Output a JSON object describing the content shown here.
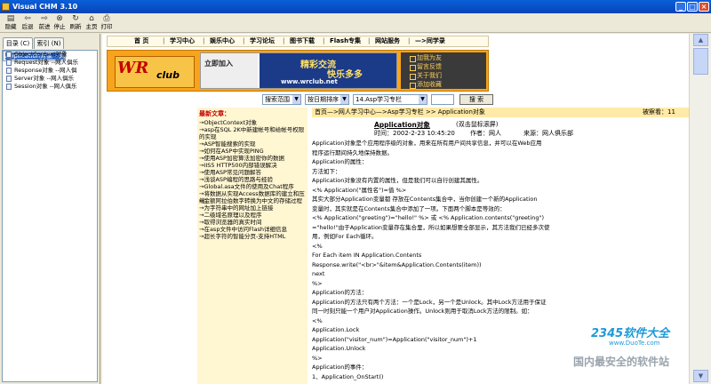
{
  "window": {
    "title": "Visual CHM 3.10",
    "minimize_glyph": "_",
    "maximize_glyph": "□",
    "close_glyph": "×"
  },
  "toolbar": {
    "buttons": [
      {
        "label": "隐藏",
        "icon": "hide-icon",
        "glyph": "▤"
      },
      {
        "label": "后退",
        "icon": "back-icon",
        "glyph": "⇦"
      },
      {
        "label": "前进",
        "icon": "forward-icon",
        "glyph": "⇨"
      },
      {
        "label": "停止",
        "icon": "stop-icon",
        "glyph": "⊗"
      },
      {
        "label": "刷新",
        "icon": "refresh-icon",
        "glyph": "↻"
      },
      {
        "label": "主页",
        "icon": "home-icon",
        "glyph": "⌂"
      },
      {
        "label": "打印",
        "icon": "print-icon",
        "glyph": "⎙"
      }
    ]
  },
  "left_pane": {
    "tabs": [
      "目录 (C)",
      "索引 (N)"
    ],
    "tree": [
      "Application对象 --网",
      "ObjectContext对象",
      "Request对象 --网人俱乐",
      "Response对象 --网人俱",
      "Server对象 --网人俱乐",
      "Session对象 --网人俱乐"
    ]
  },
  "site": {
    "nav": [
      "首 页",
      "学习中心",
      "娱乐中心",
      "学习论坛",
      "图书下载",
      "Flash专集",
      "网站服务",
      "—>同学录"
    ],
    "logo_big": "WR",
    "logo_small": "club",
    "ad_left": "立即加入",
    "ad_slogan1": "精彩交流",
    "ad_slogan2": "快乐多多",
    "ad_url": "www.wrclub.net",
    "side_links": [
      "加我为友",
      "留言反馈",
      "关于我们",
      "添加收藏"
    ],
    "search": {
      "scope": "搜索范围",
      "sort": "按日期排序",
      "category": "14.Asp学习专栏",
      "button": "搜  索"
    },
    "latest_title": "最新文章：",
    "latest": [
      "→ObjectContext对象",
      "→asp在SQL 2K中新建帐号和给帐号权限的实现",
      "→ASP智能搜索的实现",
      "→如何在ASP中实现PING",
      "→使用ASP加密算法加密你的数据",
      "→IIS5 HTTP500内部错误解决",
      "→使用ASP常见问题解答",
      "→浅谈ASP编程的思路与经验",
      "→Global.asa文件的使用及Chat程序",
      "→将数据从实现Access数据库的建立和压缩",
      "→金额阿拉伯数字转换为中文的存储过程",
      "→为字符串中的网址加上链接",
      "→二级域名原理以及程序",
      "→取得浏览器的真实时间",
      "→在asp文件中访问Flash详细信息",
      "→超长字符的智能分页-支持HTML"
    ],
    "breadcrumb": "首页—>网人学习中心—>Asp学习专栏  >>  Application对象",
    "views": "被察看：11",
    "article_title": "Application对象",
    "article_hint": "(双击鼠标滚屏)",
    "time": "时间：2002-2-23 10:45:20",
    "author": "作者：网人",
    "source": "来源：网人俱乐部",
    "body": [
      "        Application对象是个应用程序级的对象，用来在所有用户间共享信息，并可以在Web应用",
      "程序运行期间持久地保持数据。",
      "Application的属性：",
      "    方法如下：",
      "    Application对象没有内置的属性，但是我们可以自行创建其属性。",
      "    <% Application(\"属性名\")=值 %>",
      "    其实大部分Application变量都  存放在Contents集合中，当你创建一个新的Application",
      "变量时，其实就是在Contents集合中添加了一项。下面两个脚本是等效的：",
      "    <% Application(\"greeting\")=\"hello!\" %> 或 <% Application.contents(\"greeting\")",
      "=\"hello!\"由于Application变量存在集合里，所以如果想要全部显示，其方法我们已经多次使",
      "用，例如For Each循环。",
      "<%",
      "For Each item IN Application.Contents",
      "    Response.write(\"<br>\"&item&Application.Contents(item))",
      "next",
      "%>",
      "Application的方法：",
      "    Application的方法只有两个方法：一个是Lock，另一个是Unlock。其中Lock方法用于保证",
      "同一时刻只能一个用户对Application操作。Unlock则用于取消Lock方法的限制。如：",
      "<%",
      "Application.Lock",
      "Application(\"visitor_num\")=Application(\"visitor_num\")+1",
      "Application.Unlock",
      "%>",
      "Application的事件：",
      "1、Application_OnStart()"
    ]
  },
  "watermark": {
    "line1": "2345软件大全",
    "line2": "www.DuoTe.com",
    "line3": "国内最安全的软件站"
  }
}
